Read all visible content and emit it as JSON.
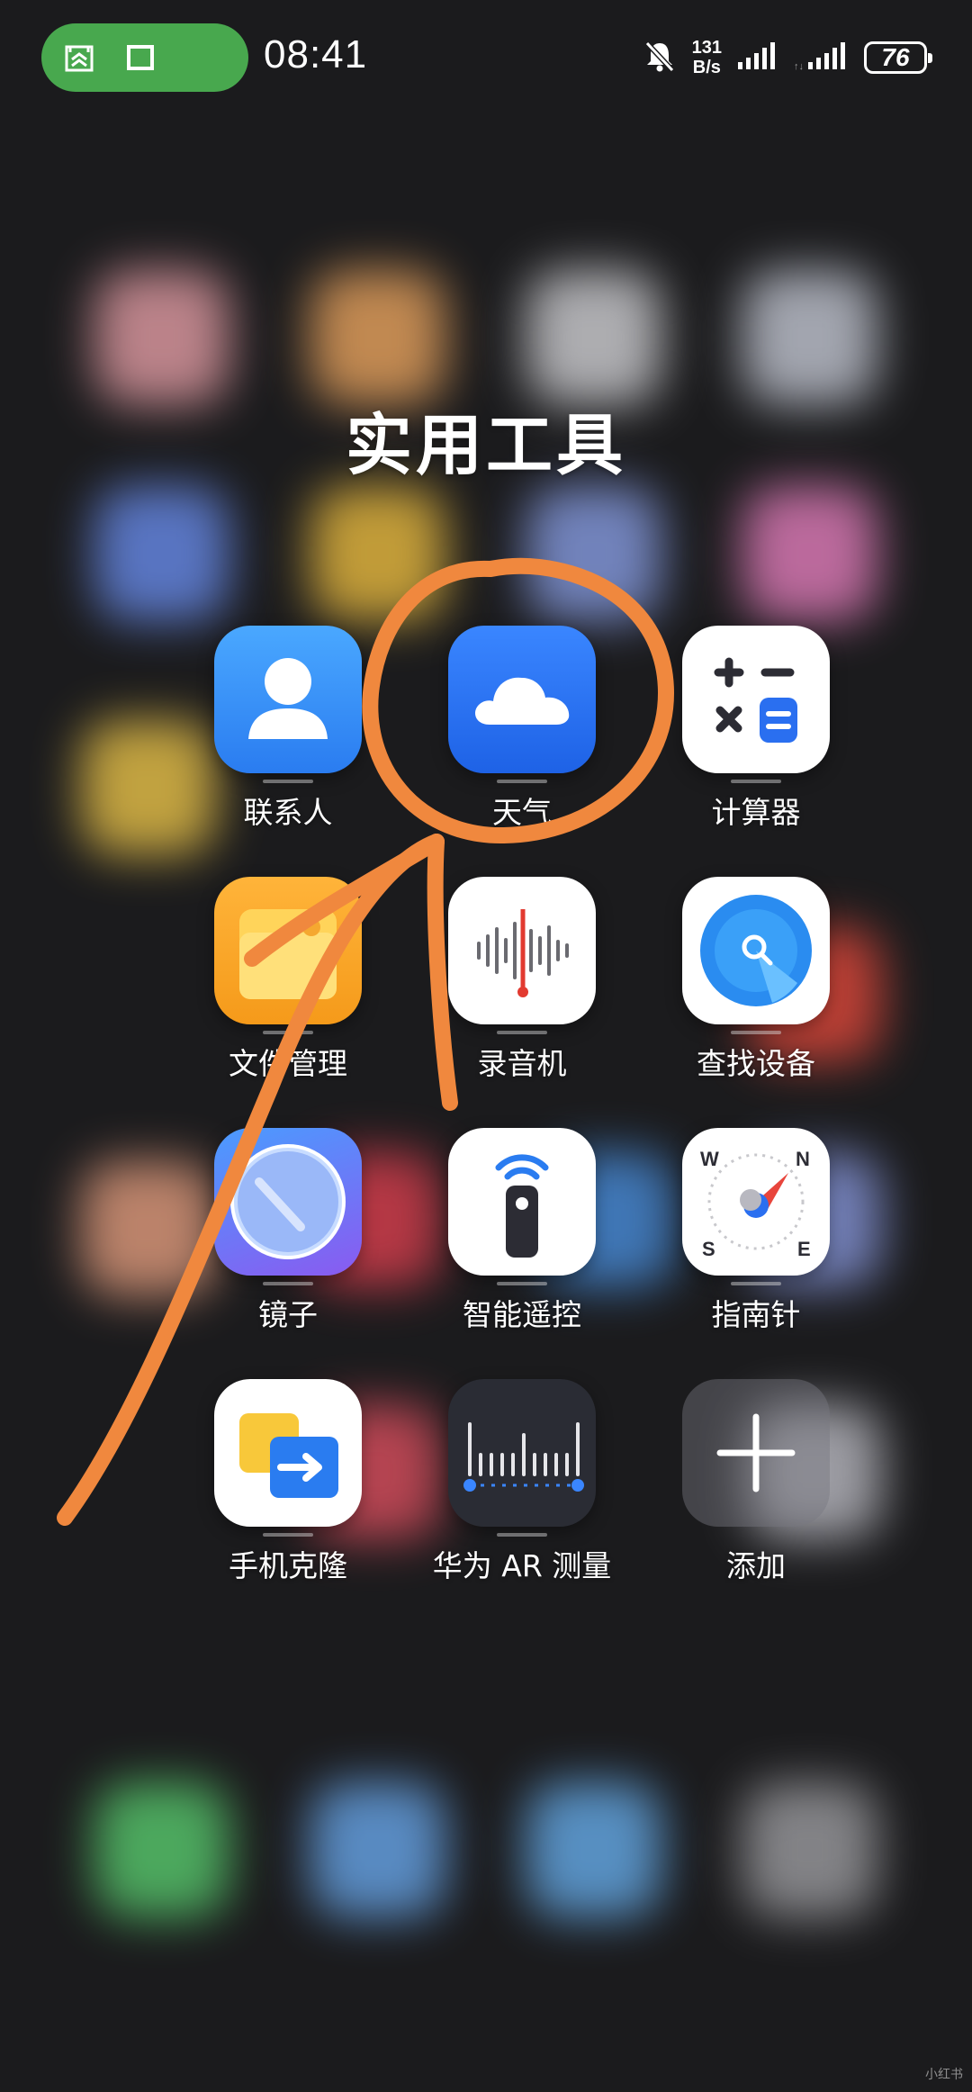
{
  "status_bar": {
    "time": "08:41",
    "net_speed_value": "131",
    "net_speed_unit": "B/s",
    "battery": "76",
    "pill_color": "#48a84e"
  },
  "folder": {
    "title": "实用工具",
    "apps": [
      {
        "label": "联系人",
        "icon": "contacts-icon"
      },
      {
        "label": "天气",
        "icon": "weather-icon"
      },
      {
        "label": "计算器",
        "icon": "calculator-icon"
      },
      {
        "label": "文件管理",
        "icon": "files-icon"
      },
      {
        "label": "录音机",
        "icon": "recorder-icon"
      },
      {
        "label": "查找设备",
        "icon": "find-device-icon"
      },
      {
        "label": "镜子",
        "icon": "mirror-icon"
      },
      {
        "label": "智能遥控",
        "icon": "remote-icon"
      },
      {
        "label": "指南针",
        "icon": "compass-icon"
      },
      {
        "label": "手机克隆",
        "icon": "phone-clone-icon"
      },
      {
        "label": "华为 AR 测量",
        "icon": "ar-measure-icon"
      },
      {
        "label": "添加",
        "icon": "add-icon"
      }
    ]
  },
  "annotation": {
    "color": "#f0883e"
  },
  "watermark": "小红书"
}
